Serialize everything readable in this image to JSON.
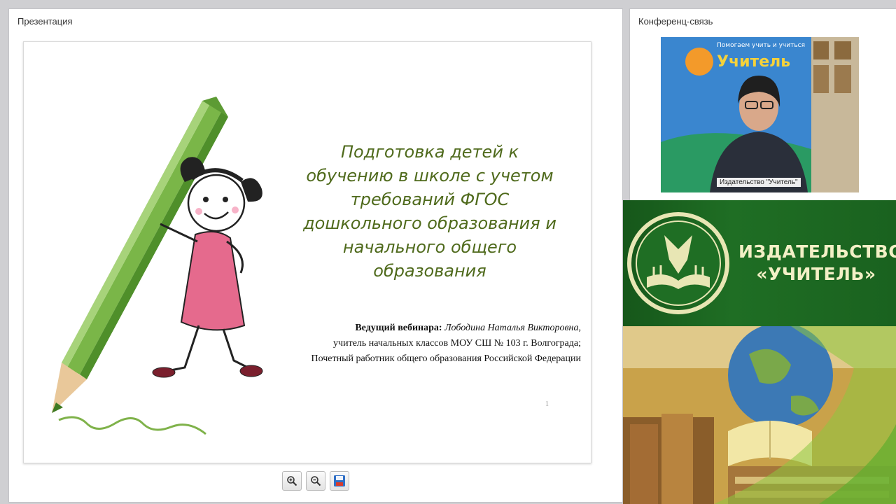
{
  "presentation": {
    "title": "Презентация",
    "slide": {
      "title": "Подготовка детей к обучению в школе с учетом требований ФГОС дошкольного образования и начального общего образования",
      "presenter_label": "Ведущий вебинара:",
      "presenter_name": "Лободина Наталья Викторовна,",
      "presenter_role": "учитель начальных классов МОУ СШ № 103 г. Волгограда;",
      "presenter_honor": "Почетный работник общего образования Российской Федерации",
      "page_number": "1"
    },
    "toolbar": {
      "zoom_in_icon": "zoom-in-icon",
      "zoom_out_icon": "zoom-out-icon",
      "save_icon": "save-icon"
    }
  },
  "conference": {
    "title": "Конференц-связь",
    "video_label": "Издательство \"Учитель\"",
    "video_banner_top": "Помогаем учить и учиться",
    "video_banner_brand": "Учитель"
  },
  "publisher_banner": {
    "line1": "ИЗДАТЕЛЬСТВО",
    "line2": "«УЧИТЕЛЬ»"
  },
  "colors": {
    "title_green": "#4f6a1c",
    "banner_green": "#1f6e24",
    "banner_text": "#f3f0c6"
  }
}
